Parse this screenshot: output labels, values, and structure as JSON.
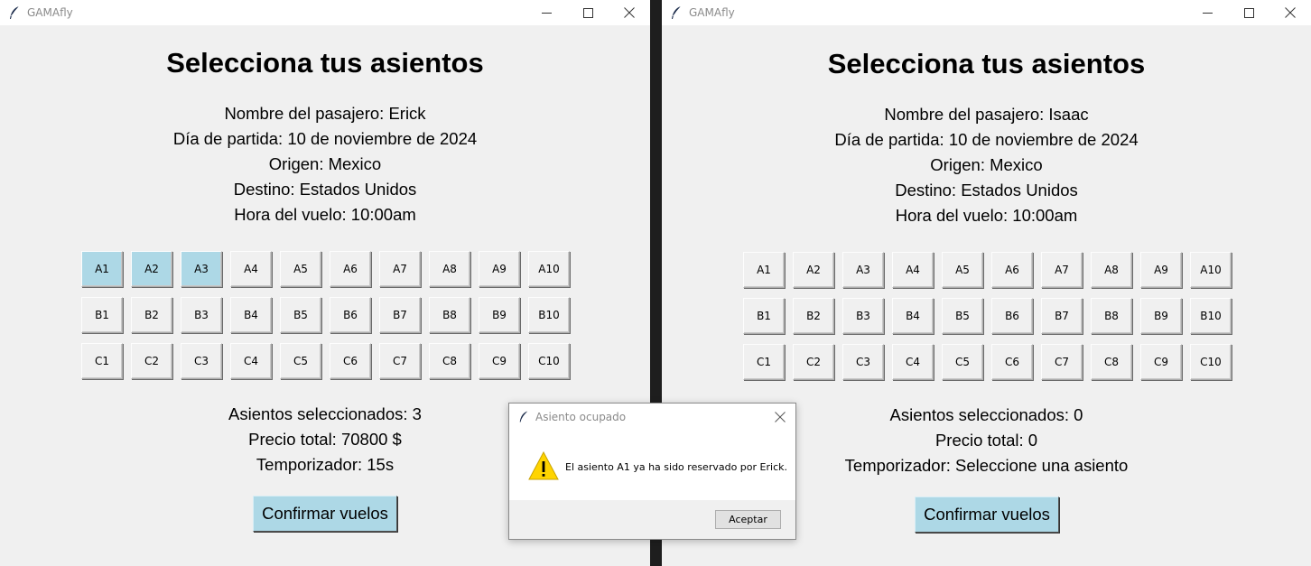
{
  "windows": [
    {
      "title": "GAMAfly",
      "heading": "Selecciona tus asientos",
      "passenger": "Nombre del pasajero: Erick",
      "date": "Día de partida: 10 de noviembre de 2024",
      "origin": "Origen: Mexico",
      "destination": "Destino: Estados Unidos",
      "time": "Hora del vuelo: 10:00am",
      "seat_rows": [
        [
          "A1",
          "A2",
          "A3",
          "A4",
          "A5",
          "A6",
          "A7",
          "A8",
          "A9",
          "A10"
        ],
        [
          "B1",
          "B2",
          "B3",
          "B4",
          "B5",
          "B6",
          "B7",
          "B8",
          "B9",
          "B10"
        ],
        [
          "C1",
          "C2",
          "C3",
          "C4",
          "C5",
          "C6",
          "C7",
          "C8",
          "C9",
          "C10"
        ]
      ],
      "selected_seats": [
        "A1",
        "A2",
        "A3"
      ],
      "selected_count": "Asientos seleccionados: 3",
      "total_price": "Precio total: 70800 $",
      "timer": "Temporizador: 15s",
      "confirm_label": "Confirmar vuelos"
    },
    {
      "title": "GAMAfly",
      "heading": "Selecciona tus asientos",
      "passenger": "Nombre del pasajero: Isaac",
      "date": "Día de partida: 10 de noviembre de 2024",
      "origin": "Origen: Mexico",
      "destination": "Destino: Estados Unidos",
      "time": "Hora del vuelo: 10:00am",
      "seat_rows": [
        [
          "A1",
          "A2",
          "A3",
          "A4",
          "A5",
          "A6",
          "A7",
          "A8",
          "A9",
          "A10"
        ],
        [
          "B1",
          "B2",
          "B3",
          "B4",
          "B5",
          "B6",
          "B7",
          "B8",
          "B9",
          "B10"
        ],
        [
          "C1",
          "C2",
          "C3",
          "C4",
          "C5",
          "C6",
          "C7",
          "C8",
          "C9",
          "C10"
        ]
      ],
      "selected_seats": [],
      "selected_count": "Asientos seleccionados: 0",
      "total_price": "Precio total: 0",
      "timer": "Temporizador: Seleccione una asiento",
      "confirm_label": "Confirmar vuelos"
    }
  ],
  "dialog": {
    "title": "Asiento ocupado",
    "message": "El asiento A1 ya ha sido reservado por Erick.",
    "ok_label": "Aceptar",
    "icon": "warning-icon"
  },
  "colors": {
    "window_bg": "#f0f0f0",
    "selected_seat": "#add8e6",
    "confirm_button": "#add8e6",
    "divider": "#1e1e1e"
  }
}
